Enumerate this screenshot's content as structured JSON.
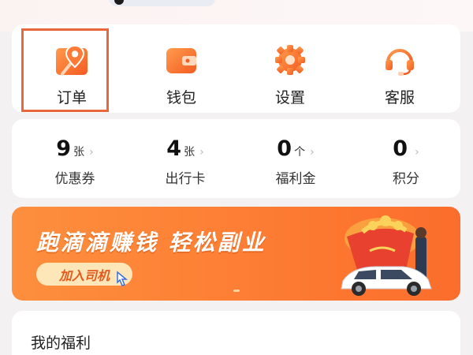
{
  "quick_actions": [
    {
      "label": "订单",
      "icon": "order-map-pin-icon"
    },
    {
      "label": "钱包",
      "icon": "wallet-icon"
    },
    {
      "label": "设置",
      "icon": "settings-gear-icon"
    },
    {
      "label": "客服",
      "icon": "headset-support-icon"
    }
  ],
  "stats": [
    {
      "value": "9",
      "unit": "张",
      "label": "优惠券"
    },
    {
      "value": "4",
      "unit": "张",
      "label": "出行卡"
    },
    {
      "value": "0",
      "unit": "个",
      "label": "福利金"
    },
    {
      "value": "0",
      "unit": "",
      "label": "积分"
    }
  ],
  "banner": {
    "title": "跑滴滴赚钱  轻松副业",
    "button_label": "加入司机"
  },
  "benefits": {
    "title": "我的福利"
  },
  "colors": {
    "accent": "#fb6f2c",
    "highlight_border": "#e8673c",
    "banner_button_bg": "#fde6b8"
  }
}
